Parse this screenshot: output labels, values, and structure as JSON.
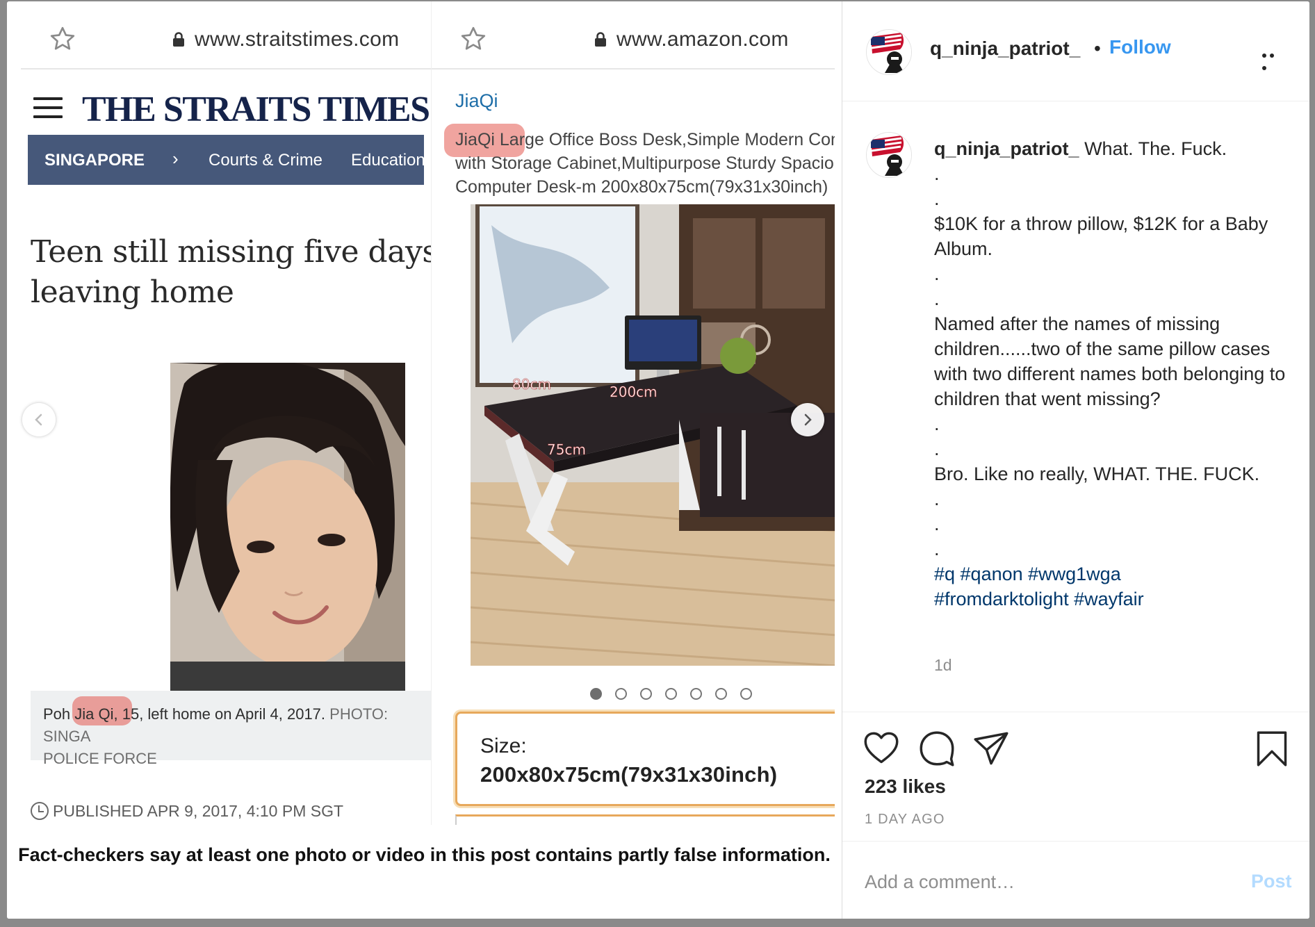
{
  "media": {
    "left_screenshot": {
      "url": "www.straitstimes.com",
      "logo": "THE STRAITS TIMES",
      "nav": [
        "SINGAPORE",
        "Courts & Crime",
        "Education"
      ],
      "nav_chevron": "›",
      "headline_line1": "Teen still missing five days",
      "headline_line2": "leaving home",
      "caption_main": "Poh Jia Qi, 15, left home on April 4, 2017.",
      "caption_credit_line1": "PHOTO: SINGA",
      "caption_credit_line2": "POLICE FORCE",
      "published": "PUBLISHED  APR 9, 2017, 4:10 PM SGT"
    },
    "right_screenshot": {
      "url": "www.amazon.com",
      "brand": "JiaQi",
      "title_line1": "JiaQi Large Office Boss Desk,Simple Modern Com",
      "title_line2": "with Storage Cabinet,Multipurpose Sturdy Spacio",
      "title_line3": "Computer Desk-m 200x80x75cm(79x31x30inch)",
      "dims": [
        "80cm",
        "200cm",
        "75cm"
      ],
      "carousel_dots": 7,
      "carousel_active": 0,
      "size_label": "Size:",
      "size_value": "200x80x75cm(79x31x30inch)"
    },
    "factcheck_notice": "Fact-checkers say at least one photo or video in this post contains partly false information."
  },
  "post": {
    "username": "q_ninja_patriot_",
    "separator": "•",
    "follow_label": "Follow",
    "caption_lines": [
      ".",
      ".",
      "$10K for a throw pillow, $12K for a Baby Album.",
      ".",
      ".",
      "Named after the names of missing children......two of the same pillow cases with two different names both belonging to children that went missing?",
      ".",
      ".",
      "Bro. Like no really, WHAT. THE. FUCK.",
      ".",
      ".",
      "."
    ],
    "caption_first": "What. The. Fuck.",
    "hashtags_line1": "#q #qanon #wwg1wga",
    "hashtags_line2": "#fromdarktolight #wayfair",
    "caption_age": "1d",
    "likes": "223 likes",
    "time": "1 DAY AGO",
    "comment_placeholder": "Add a comment…",
    "post_label": "Post"
  },
  "colors": {
    "follow": "#3897f0",
    "hashtag": "#00376b",
    "st_nav": "#46587a",
    "st_logo": "#15234a",
    "highlight": "#e45a50"
  }
}
